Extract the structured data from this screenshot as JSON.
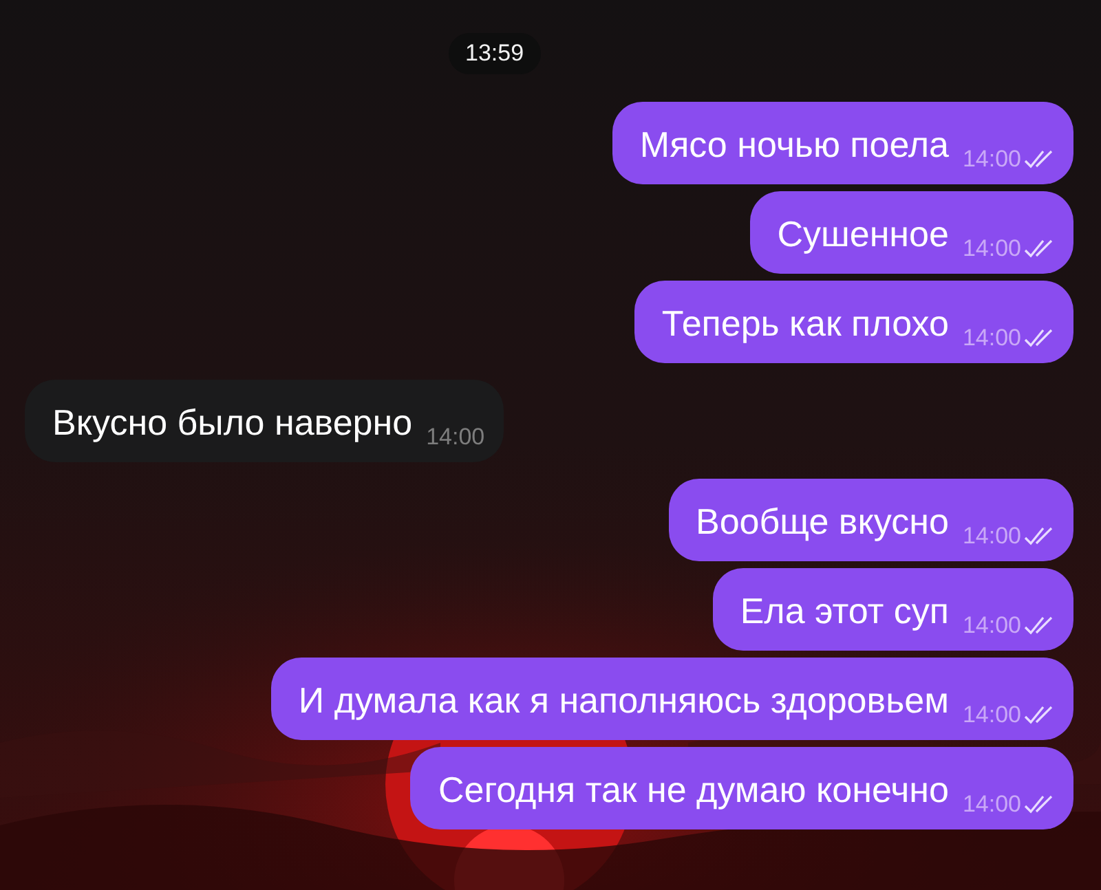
{
  "date_pill": "13:59",
  "messages": [
    {
      "kind": "outgoing",
      "text": "Мясо ночью поела",
      "time": "14:00",
      "read": true
    },
    {
      "kind": "outgoing",
      "text": "Сушенное",
      "time": "14:00",
      "read": true
    },
    {
      "kind": "outgoing",
      "text": "Теперь как плохо",
      "time": "14:00",
      "read": true
    },
    {
      "kind": "incoming",
      "text": "Вкусно было наверно",
      "time": "14:00"
    },
    {
      "kind": "outgoing",
      "text": "Вообще вкусно",
      "time": "14:00",
      "read": true
    },
    {
      "kind": "outgoing",
      "text": "Ела этот суп",
      "time": "14:00",
      "read": true
    },
    {
      "kind": "outgoing",
      "text": "И думала как я наполняюсь здоровьем",
      "time": "14:00",
      "read": true
    },
    {
      "kind": "outgoing",
      "text": "Сегодня так не думаю конечно",
      "time": "14:00",
      "read": true
    }
  ]
}
